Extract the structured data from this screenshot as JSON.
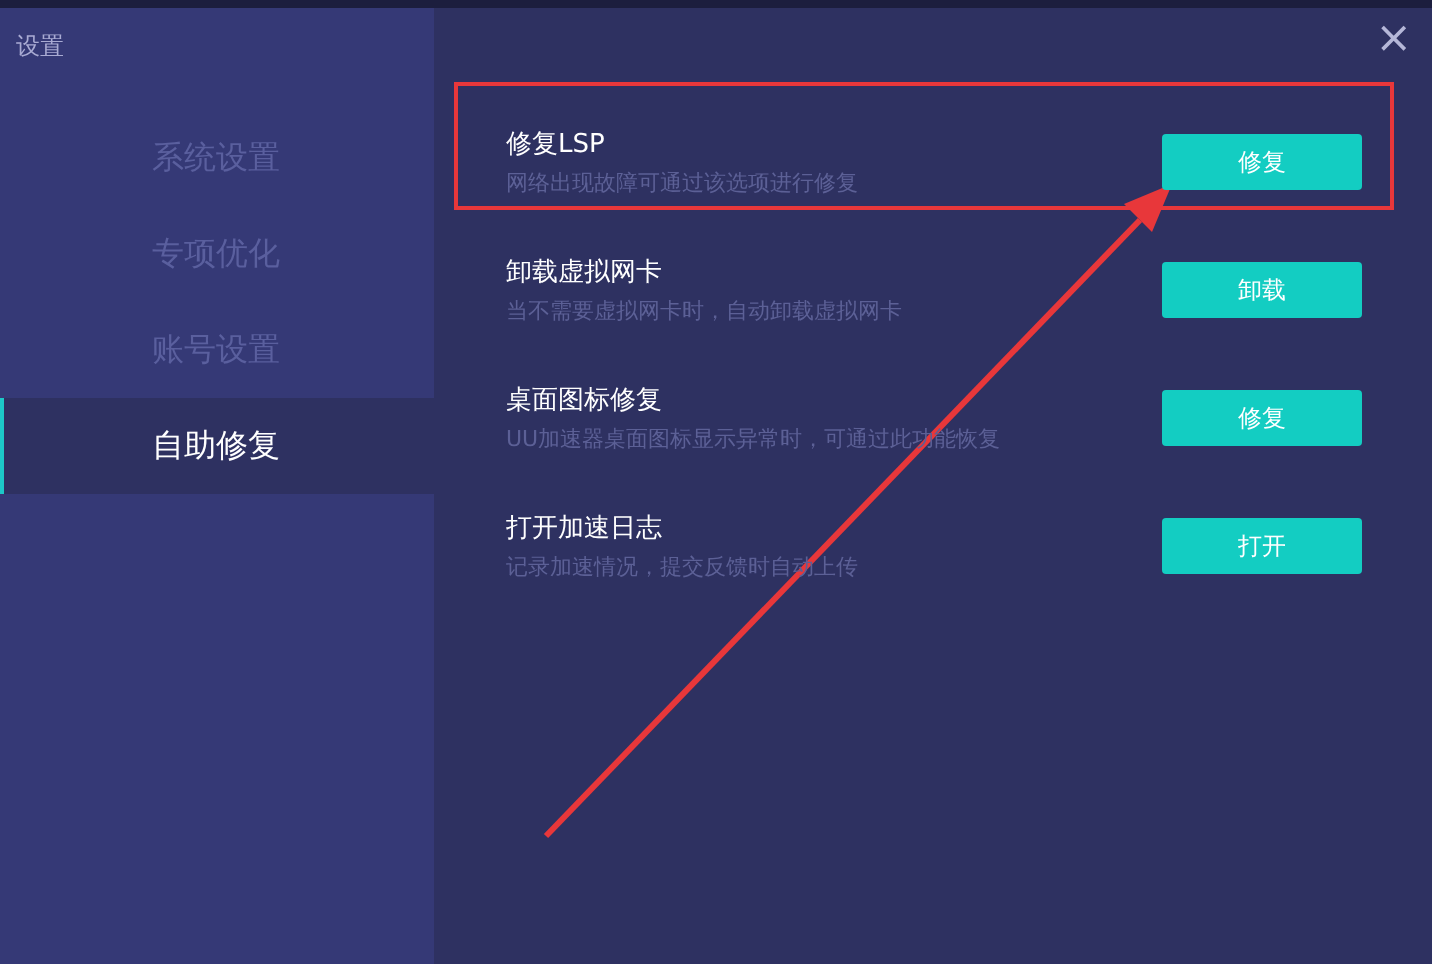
{
  "window": {
    "title": "设置",
    "close": "×"
  },
  "sidebar": {
    "items": [
      {
        "label": "系统设置",
        "selected": false
      },
      {
        "label": "专项优化",
        "selected": false
      },
      {
        "label": "账号设置",
        "selected": false
      },
      {
        "label": "自助修复",
        "selected": true
      }
    ]
  },
  "options": [
    {
      "title": "修复LSP",
      "description": "网络出现故障可通过该选项进行修复",
      "button": "修复"
    },
    {
      "title": "卸载虚拟网卡",
      "description": "当不需要虚拟网卡时，自动卸载虚拟网卡",
      "button": "卸载"
    },
    {
      "title": "桌面图标修复",
      "description": "UU加速器桌面图标显示异常时，可通过此功能恢复",
      "button": "修复"
    },
    {
      "title": "打开加速日志",
      "description": "记录加速情况，提交反馈时自动上传",
      "button": "打开"
    }
  ]
}
